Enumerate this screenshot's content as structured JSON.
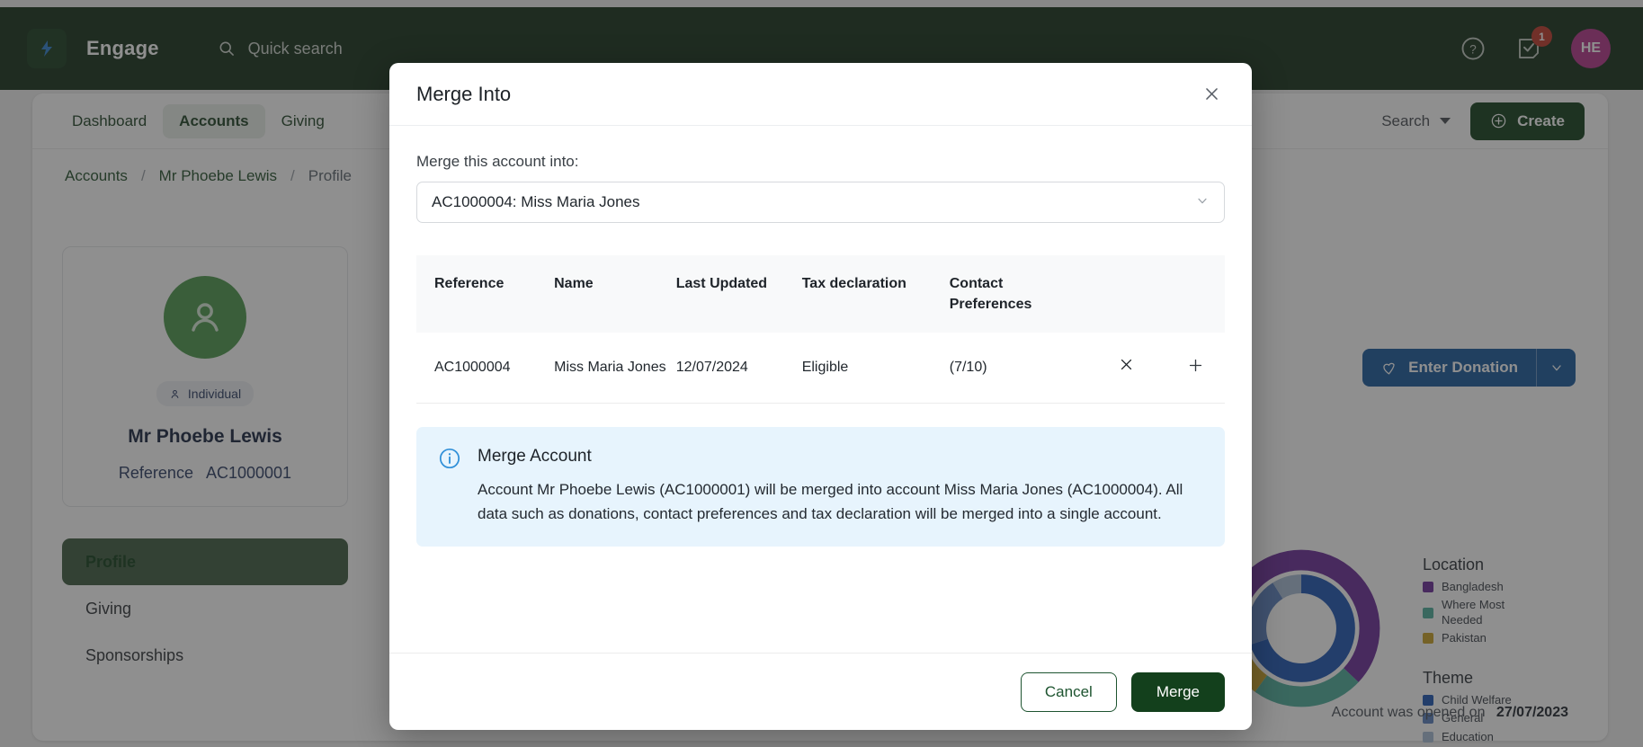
{
  "topbar": {
    "brand": "Engage",
    "logo_icon": "lightning-logo-icon",
    "search_placeholder": "Quick search",
    "search_icon": "search-icon",
    "help_icon": "help-circle-icon",
    "tasks_icon": "task-checkbox-icon",
    "tasks_badge": "1",
    "avatar_initials": "HE",
    "colors": {
      "bar": "#153019",
      "badge": "#c0392b",
      "avatar": "#b3358a"
    }
  },
  "nav": {
    "tabs": [
      {
        "label": "Dashboard",
        "active": false
      },
      {
        "label": "Accounts",
        "active": true
      },
      {
        "label": "Giving",
        "active": false
      }
    ],
    "search_label": "Search",
    "create_label": "Create",
    "create_icon": "plus-circle-icon"
  },
  "breadcrumb": {
    "items": [
      "Accounts",
      "Mr Phoebe Lewis",
      "Profile"
    ],
    "separator": "/"
  },
  "profile": {
    "avatar_icon": "person-avatar-icon",
    "type_chip": "Individual",
    "type_chip_icon": "person-small-icon",
    "name": "Mr Phoebe Lewis",
    "reference_label": "Reference",
    "reference_value": "AC1000001"
  },
  "side_menu": {
    "items": [
      {
        "label": "Profile",
        "active": true
      },
      {
        "label": "Giving",
        "active": false
      },
      {
        "label": "Sponsorships",
        "active": false
      }
    ]
  },
  "actions": {
    "donation_label": "Enter Donation",
    "donation_icon": "heart-icon",
    "donation_caret_icon": "chevron-down-icon"
  },
  "footer_note": {
    "label": "Account was opened on",
    "date": "27/07/2023"
  },
  "chart_data": {
    "type": "pie",
    "title": "",
    "legend_position": "right",
    "rings": [
      {
        "name": "Location",
        "categories": [
          "Bangladesh",
          "Where Most Needed",
          "Pakistan"
        ],
        "values": [
          62,
          23,
          15
        ],
        "colors": [
          "#6b2d99",
          "#4fae9c",
          "#c9a227"
        ]
      },
      {
        "name": "Theme",
        "categories": [
          "Child Welfare",
          "General",
          "Education"
        ],
        "values": [
          70,
          21,
          9
        ],
        "colors": [
          "#1f57b5",
          "#5a7fbf",
          "#a8bdd6"
        ]
      }
    ]
  },
  "modal": {
    "title": "Merge Into",
    "close_icon": "close-icon",
    "field_label": "Merge this account into:",
    "select_value": "AC1000004: Miss Maria Jones",
    "select_caret_icon": "chevron-down-icon",
    "table": {
      "columns": [
        "Reference",
        "Name",
        "Last Updated",
        "Tax declaration",
        "Contact Preferences"
      ],
      "rows": [
        {
          "reference": "AC1000004",
          "name": "Miss Maria Jones",
          "last_updated": "12/07/2024",
          "tax_declaration": "Eligible",
          "contact_preferences": "(7/10)",
          "remove_icon": "x-icon",
          "expand_icon": "plus-icon"
        }
      ]
    },
    "info": {
      "icon": "info-circle-icon",
      "heading": "Merge Account",
      "body": "Account Mr Phoebe Lewis (AC1000001) will be merged into account Miss Maria Jones (AC1000004). All data such as donations, contact preferences and tax declaration will be merged into a single account."
    },
    "cancel_label": "Cancel",
    "merge_label": "Merge"
  }
}
